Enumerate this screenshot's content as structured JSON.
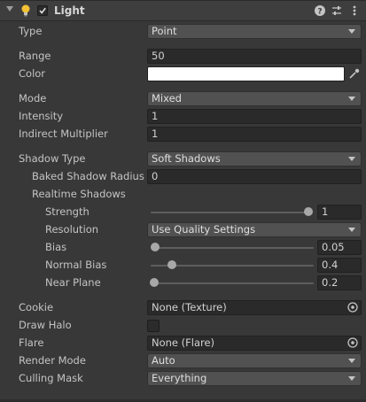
{
  "header": {
    "title": "Light",
    "enabled": true,
    "icons": [
      "foldout-arrow-icon",
      "light-bulb-icon",
      "help-icon",
      "presets-icon",
      "more-menu-icon"
    ]
  },
  "fields": {
    "type": {
      "label": "Type",
      "value": "Point"
    },
    "range": {
      "label": "Range",
      "value": "50"
    },
    "color": {
      "label": "Color",
      "value": "#ffffff"
    },
    "mode": {
      "label": "Mode",
      "value": "Mixed"
    },
    "intensity": {
      "label": "Intensity",
      "value": "1"
    },
    "indirect_multiplier": {
      "label": "Indirect Multiplier",
      "value": "1"
    },
    "shadow_type": {
      "label": "Shadow Type",
      "value": "Soft Shadows"
    },
    "baked_shadow_radius": {
      "label": "Baked Shadow Radius",
      "value": "0"
    },
    "realtime_shadows": {
      "label": "Realtime Shadows"
    },
    "strength": {
      "label": "Strength",
      "value": "1",
      "slider_fraction": 1.0
    },
    "resolution": {
      "label": "Resolution",
      "value": "Use Quality Settings"
    },
    "bias": {
      "label": "Bias",
      "value": "0.05",
      "slider_fraction": 0.025
    },
    "normal_bias": {
      "label": "Normal Bias",
      "value": "0.4",
      "slider_fraction": 0.133
    },
    "near_plane": {
      "label": "Near Plane",
      "value": "0.2",
      "slider_fraction": 0.02
    },
    "cookie": {
      "label": "Cookie",
      "value": "None (Texture)"
    },
    "draw_halo": {
      "label": "Draw Halo",
      "checked": false
    },
    "flare": {
      "label": "Flare",
      "value": "None (Flare)"
    },
    "render_mode": {
      "label": "Render Mode",
      "value": "Auto"
    },
    "culling_mask": {
      "label": "Culling Mask",
      "value": "Everything"
    }
  },
  "colors": {
    "panel": "#383838",
    "field": "#2a2a2a",
    "dropdown": "#515151",
    "bulb": "#f2c233"
  }
}
